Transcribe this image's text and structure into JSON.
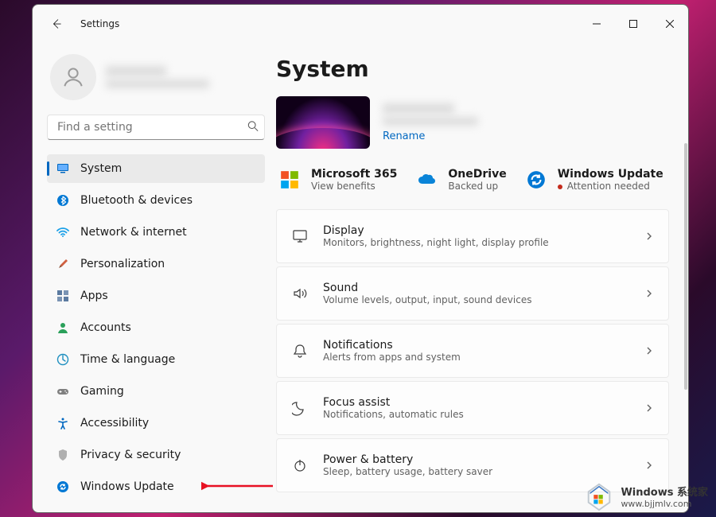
{
  "window": {
    "title": "Settings"
  },
  "search": {
    "placeholder": "Find a setting"
  },
  "nav": [
    {
      "label": "System",
      "icon": "monitor-icon",
      "active": true,
      "color": "#0067c0"
    },
    {
      "label": "Bluetooth & devices",
      "icon": "bluetooth-icon",
      "color": "#0078d4"
    },
    {
      "label": "Network & internet",
      "icon": "wifi-icon",
      "color": "#1aa0e8"
    },
    {
      "label": "Personalization",
      "icon": "brush-icon",
      "color": "#d06040"
    },
    {
      "label": "Apps",
      "icon": "apps-icon",
      "color": "#5b7aa0"
    },
    {
      "label": "Accounts",
      "icon": "person-icon",
      "color": "#2aa05a"
    },
    {
      "label": "Time & language",
      "icon": "clock-globe-icon",
      "color": "#2090c0"
    },
    {
      "label": "Gaming",
      "icon": "gamepad-icon",
      "color": "#808080"
    },
    {
      "label": "Accessibility",
      "icon": "accessibility-icon",
      "color": "#0067c0"
    },
    {
      "label": "Privacy & security",
      "icon": "shield-icon",
      "color": "#8a8a8a"
    },
    {
      "label": "Windows Update",
      "icon": "update-icon",
      "color": "#0078d4"
    }
  ],
  "page": {
    "title": "System",
    "rename": "Rename",
    "status": [
      {
        "icon": "ms365-icon",
        "title": "Microsoft 365",
        "sub": "View benefits"
      },
      {
        "icon": "onedrive-icon",
        "title": "OneDrive",
        "sub": "Backed up"
      },
      {
        "icon": "winupdate-icon",
        "title": "Windows Update",
        "sub": "Attention needed",
        "alert": true
      }
    ],
    "settings": [
      {
        "icon": "display-icon",
        "title": "Display",
        "sub": "Monitors, brightness, night light, display profile"
      },
      {
        "icon": "sound-icon",
        "title": "Sound",
        "sub": "Volume levels, output, input, sound devices"
      },
      {
        "icon": "bell-icon",
        "title": "Notifications",
        "sub": "Alerts from apps and system"
      },
      {
        "icon": "moon-icon",
        "title": "Focus assist",
        "sub": "Notifications, automatic rules"
      },
      {
        "icon": "power-icon",
        "title": "Power & battery",
        "sub": "Sleep, battery usage, battery saver"
      }
    ]
  },
  "watermark": {
    "line1": "Windows 系统家",
    "line2": "www.bjjmlv.com"
  }
}
